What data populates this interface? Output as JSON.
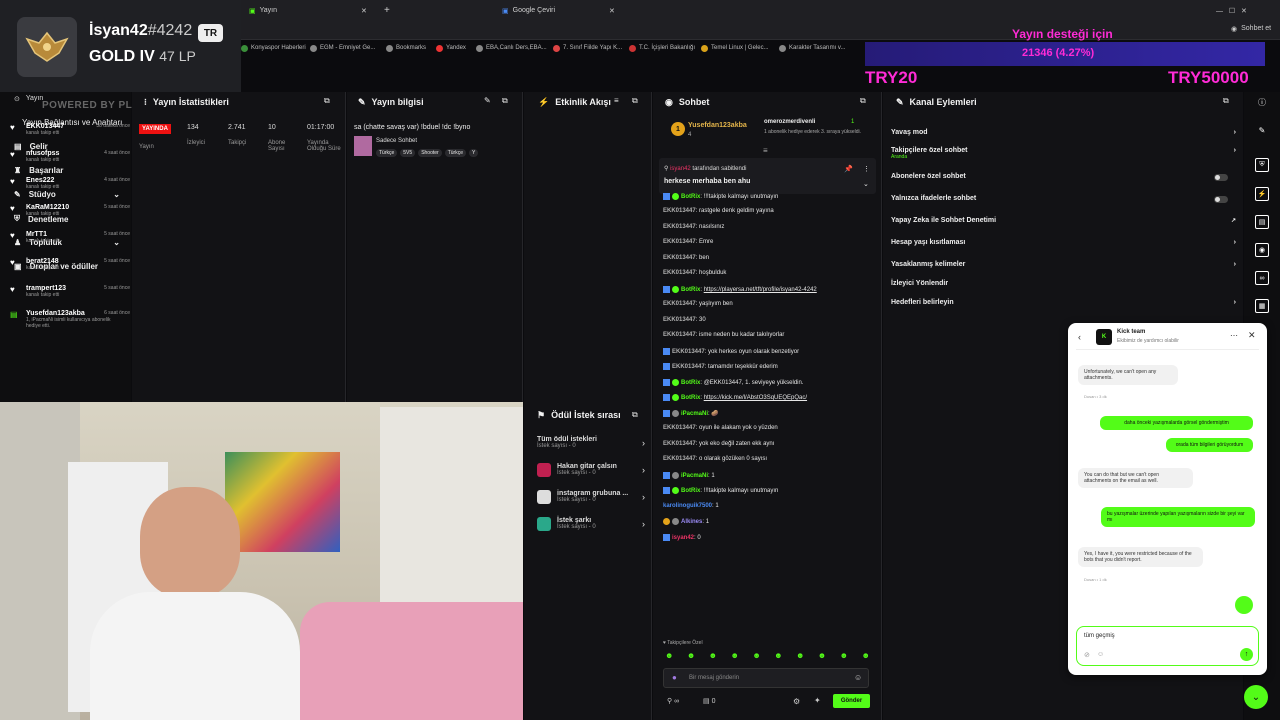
{
  "browser": {
    "tabs": [
      "Yayın",
      "Google Çeviri"
    ],
    "new_tab": "+",
    "bookmarks": [
      "Konyaspor Haberleri",
      "EGM - Emniyet Ge...",
      "Bookmarks",
      "Yandex",
      "EBA,Canlı Ders,EBA...",
      "7. Sınıf Fiilde Yapı K...",
      "T.C. İçişleri Bakanlığı",
      "Temel Linux | Gelec...",
      "Karakter Tasarımı v..."
    ],
    "right_label": "Sohbet et"
  },
  "rank": {
    "name": "İsyan42",
    "tag": "#4242",
    "region": "TR",
    "tier": "GOLD IV",
    "lp": "47 LP"
  },
  "overlay": {
    "donation_title": "Yayın desteği için",
    "donation_progress": "21346 (4.27%)",
    "left_amount": "TRY20",
    "right_amount": "TRY50000",
    "watermark": "POWERED BY PLAYERSENET17TT"
  },
  "nav": {
    "yayin": "Yayın",
    "connections": "Yayın Bağlantısı ve Anahtarı",
    "items": [
      "Gelir",
      "Başarılar",
      "Stüdyo",
      "Denetleme",
      "Topluluk",
      "Droplar ve ödüller"
    ]
  },
  "stats": {
    "title": "Yayın İstatistikleri",
    "live": "YAYINDA",
    "live_label": "Yayın",
    "viewers": "134",
    "viewers_label": "İzleyici",
    "followers": "2.741",
    "followers_label": "Takipçi",
    "subs": "10",
    "subs_label": "Abone Sayısı",
    "uptime": "01:17:00",
    "uptime_label": "Yayında Olduğu Süre"
  },
  "info": {
    "title": "Yayın bilgisi",
    "stream_title": "sa (chatte savaş var) !bduel !dc !byno",
    "category": "Sadece Sohbet",
    "tags": [
      "Türkçe",
      "5V5",
      "Shooter",
      "Türkçe",
      "Y"
    ]
  },
  "activity": {
    "title": "Etkinlik Akışı",
    "items": [
      {
        "user": "EKK013447",
        "desc": "kanalı takip etti",
        "time": "38 dakika önce"
      },
      {
        "user": "nfusofpss",
        "desc": "kanalı takip etti",
        "time": "4 saat önce"
      },
      {
        "user": "Enes222",
        "desc": "kanalı takip etti",
        "time": "4 saat önce"
      },
      {
        "user": "KaRaM12210",
        "desc": "kanalı takip etti",
        "time": "5 saat önce"
      },
      {
        "user": "MrTT1",
        "desc": "kanalı takip etti",
        "time": "5 saat önce"
      },
      {
        "user": "berat2148",
        "desc": "kanalı takip etti",
        "time": "5 saat önce"
      },
      {
        "user": "trampert123",
        "desc": "kanalı takip etti",
        "time": "5 saat önce"
      },
      {
        "user": "Yusefdan123akba",
        "desc": "1, iPacmaNi isimli kullanıcıya abonelik hediye etti.",
        "time": "6 saat önce"
      }
    ]
  },
  "rewards": {
    "title": "Ödül İstek sırası",
    "all": "Tüm ödül istekleri",
    "all_sub": "İstek sayısı - 0",
    "items": [
      {
        "name": "Hakan gitar çalsın",
        "sub": "İstek sayısı - 0"
      },
      {
        "name": "instagram grubuna ...",
        "sub": "İstek sayısı - 0"
      },
      {
        "name": "İstek şarkı",
        "sub": "İstek sayısı - 0"
      }
    ]
  },
  "chat": {
    "title": "Sohbet",
    "pinned_user": "Yusefdan123akba",
    "pinned_count": "4",
    "pinned_other": "omerozmerdivenli",
    "pinned_other_count": "1",
    "pinned_other_desc": "1 abonelik hediye ederek 3. sıraya yükseldi.",
    "pin_by": "tarafından sabitlendi",
    "pin_by_user": "isyan42",
    "pin_msg": "herkese merhaba ben ahu",
    "messages": [
      {
        "user": "BotRix",
        "text": "!!!takipte kalmayı unutmayın"
      },
      {
        "user": "EKK013447",
        "text": "rastgele denk geldim yayına"
      },
      {
        "user": "EKK013447",
        "text": "nasılsınız"
      },
      {
        "user": "EKK013447",
        "text": "Emre"
      },
      {
        "user": "EKK013447",
        "text": "ben"
      },
      {
        "user": "EKK013447",
        "text": "hoşbulduk"
      },
      {
        "user": "BotRix",
        "text": "https://playersa.net/tft/profile/isyan42-4242"
      },
      {
        "user": "EKK013447",
        "text": "yaşlıyım ben"
      },
      {
        "user": "EKK013447",
        "text": "30"
      },
      {
        "user": "EKK013447",
        "text": "isme neden bu kadar takılıyorlar"
      },
      {
        "user": "EKK013447",
        "text": "yok herkes oyun olarak benzetiyor"
      },
      {
        "user": "EKK013447",
        "text": "tamamdır teşekkür ederim"
      },
      {
        "user": "BotRix",
        "text": "@EKK013447, 1. seviyeye yükseldin."
      },
      {
        "user": "BotRix",
        "text": "https://kick.me/l/AbstO3SqUEQEpQac/"
      },
      {
        "user": "iPacmaNi",
        "text": "🥔"
      },
      {
        "user": "EKK013447",
        "text": "oyun ile alakam yok o yüzden"
      },
      {
        "user": "EKK013447",
        "text": "yok eko değil zaten ekk aynı"
      },
      {
        "user": "EKK013447",
        "text": "o olarak gözüken 0 sayısı"
      },
      {
        "user": "iPacmaNi",
        "text": "1"
      },
      {
        "user": "BotRix",
        "text": "!!!takipte kalmayı unutmayın"
      },
      {
        "user": "karolinoguik7500",
        "text": "1"
      },
      {
        "user": "Alkines",
        "text": "1"
      },
      {
        "user": "isyan42",
        "text": "0"
      }
    ],
    "followers_only": "Takipçilere Özel",
    "input_placeholder": "Bir mesaj gönderin",
    "count": "0",
    "send": "Gönder"
  },
  "actions": {
    "title": "Kanal Eylemleri",
    "items": [
      {
        "label": "Yavaş mod",
        "sub": "",
        "control": "chevron"
      },
      {
        "label": "Takipçilere özel sohbet",
        "sub": "Aranda",
        "control": "chevron"
      },
      {
        "label": "Abonelere özel sohbet",
        "sub": "",
        "control": "toggle"
      },
      {
        "label": "Yalnızca ifadelerle sohbet",
        "sub": "",
        "control": "toggle"
      },
      {
        "label": "Yapay Zeka ile Sohbet Denetimi",
        "sub": "",
        "control": "link"
      },
      {
        "label": "Hesap yaşı kısıtlaması",
        "sub": "",
        "control": "chevron"
      },
      {
        "label": "Yasaklanmış kelimeler",
        "sub": "",
        "control": "chevron"
      },
      {
        "label": "İzleyici Yönlendir",
        "sub": "",
        "control": "none"
      },
      {
        "label": "Hedefleri belirleyin",
        "sub": "",
        "control": "chevron"
      }
    ]
  },
  "support": {
    "title": "Kick team",
    "subtitle": "Ekibimiz de yardımcı olabilir",
    "messages": [
      {
        "side": "left",
        "text": "Unfortunately, we can't open any attachments.",
        "meta": "Dusan • 3 dk"
      },
      {
        "side": "right",
        "text": "daha önceki yazışmalarda görsel göndermiştim"
      },
      {
        "side": "right",
        "text": "orada tüm bilgileri görüyordum"
      },
      {
        "side": "left",
        "text": "You can do that but we can't open attachments on the email as well.",
        "meta": ""
      },
      {
        "side": "right",
        "text": "bu yazışmalar üzerinde yapılan yazışmaların sizde bir şeyi var mı"
      },
      {
        "side": "left",
        "text": "Yes, I have it, you were restricted because of the bots that you didn't report.",
        "meta": "Dusan • 1 dk"
      }
    ],
    "input_value": "tüm geçmiş"
  }
}
